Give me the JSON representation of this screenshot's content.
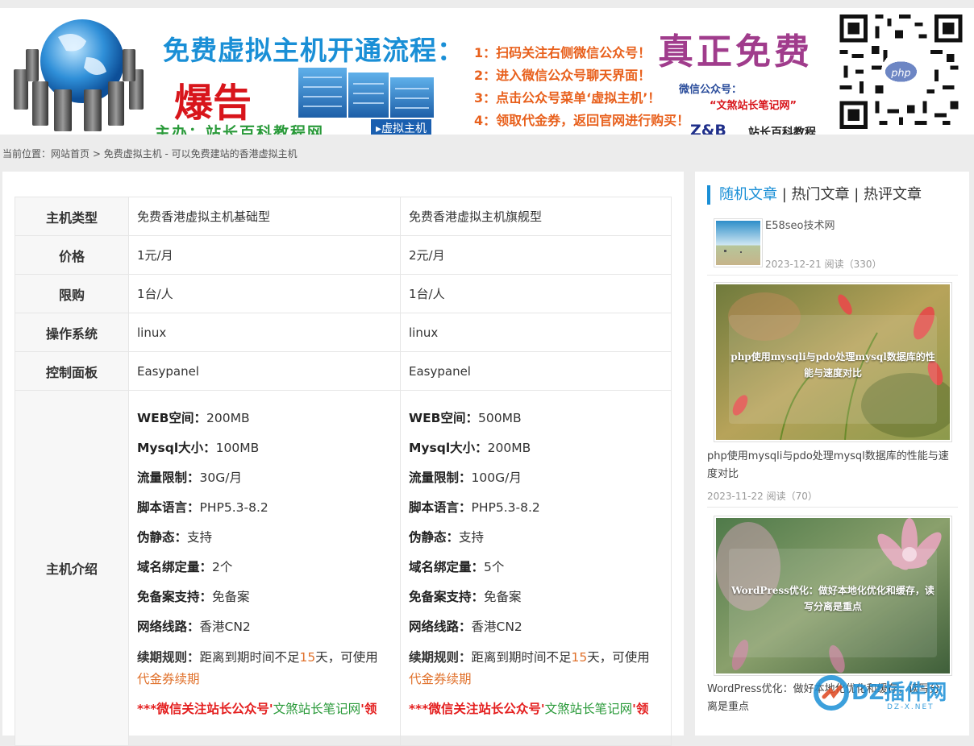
{
  "banner": {
    "title": "免费虚拟主机开通流程：",
    "warn": "爆告",
    "host_line": "主办：站长百科教程网",
    "tag": "虚拟主机",
    "steps": [
      "1：扫码关注右侧微信公众号！",
      "2：进入微信公众号聊天界面！",
      "3：点击公众号菜单‘虚拟主机’！",
      "4：领取代金券，返回官网进行购买！"
    ],
    "free": "真正免费",
    "wechat_label": "微信公众号：",
    "wechat_name": "“文煞站长笔记网”",
    "zb": "Z&B",
    "zb_text": "站长百科教程"
  },
  "breadcrumb": {
    "prefix": "当前位置：",
    "home": "网站首页",
    "sep": " > ",
    "current": "免费虚拟主机 - 可以免费建站的香港虚拟主机"
  },
  "spec": {
    "rows": [
      {
        "label": "主机类型",
        "a": "免费香港虚拟主机基础型",
        "b": "免费香港虚拟主机旗舰型"
      },
      {
        "label": "价格",
        "a": "1元/月",
        "b": "2元/月"
      },
      {
        "label": "限购",
        "a": "1台/人",
        "b": "1台/人"
      },
      {
        "label": "操作系统",
        "a": "linux",
        "b": "linux"
      },
      {
        "label": "控制面板",
        "a": "Easypanel",
        "b": "Easypanel"
      }
    ],
    "intro_label": "主机介绍",
    "a": {
      "lines": [
        {
          "k": "WEB空间：",
          "v": "200MB"
        },
        {
          "k": "Mysql大小：",
          "v": "100MB"
        },
        {
          "k": "流量限制：",
          "v": "30G/月"
        },
        {
          "k": "脚本语言：",
          "v": "PHP5.3-8.2"
        },
        {
          "k": "伪静态：",
          "v": "支持"
        },
        {
          "k": "域名绑定量：",
          "v": "2个"
        },
        {
          "k": "免备案支持：",
          "v": "免备案"
        },
        {
          "k": "网络线路：",
          "v": "香港CN2"
        }
      ]
    },
    "b": {
      "lines": [
        {
          "k": "WEB空间：",
          "v": "500MB"
        },
        {
          "k": "Mysql大小：",
          "v": "200MB"
        },
        {
          "k": "流量限制：",
          "v": "100G/月"
        },
        {
          "k": "脚本语言：",
          "v": "PHP5.3-8.2"
        },
        {
          "k": "伪静态：",
          "v": "支持"
        },
        {
          "k": "域名绑定量：",
          "v": "5个"
        },
        {
          "k": "免备案支持：",
          "v": "免备案"
        },
        {
          "k": "网络线路：",
          "v": "香港CN2"
        }
      ]
    },
    "renew": {
      "k": "续期规则：",
      "pre": "距离到期时间不足",
      "days": "15",
      "post": "天，可使用",
      "link": "代金券续期"
    },
    "notice": {
      "pre": "***微信关注站长公众号'",
      "name": "文煞站长笔记网",
      "post": "'领"
    }
  },
  "sidebar": {
    "tabs": [
      "随机文章",
      "热门文章",
      "热评文章"
    ],
    "tab_sep": " | ",
    "articles": [
      {
        "title": "E58seo技术网",
        "date": "2023-12-21",
        "views_label": "阅读",
        "views": "（330）"
      },
      {
        "title": "php使用mysqli与pdo处理mysql数据库的性能与速度对比",
        "caption": "php使用mysqli与pdo处理mysql数据库的性能与速度对比",
        "date": "2023-11-22",
        "views_label": "阅读",
        "views": "（70）"
      },
      {
        "title": "WordPress优化：做好本地化优化和缓存，读写分离是重点",
        "caption": "WordPress优化：做好本地化优化和缓存，读写分离是重点"
      }
    ]
  },
  "watermark": {
    "text": "DZ插件网",
    "sub": "DZ-X.NET"
  }
}
